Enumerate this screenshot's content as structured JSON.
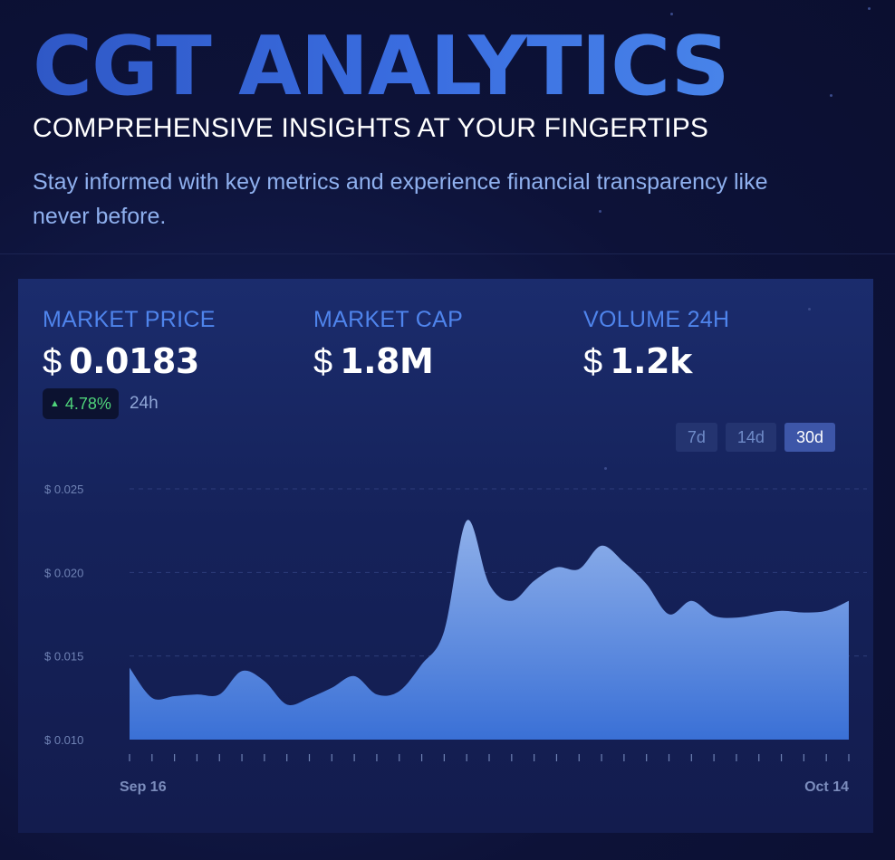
{
  "hero": {
    "title": "CGT ANALYTICS",
    "subtitle": "COMPREHENSIVE INSIGHTS AT YOUR FINGERTIPS",
    "description": "Stay informed with key metrics and experience financial transparency like never before."
  },
  "metrics": {
    "market_price": {
      "label": "MARKET PRICE",
      "currency": "$",
      "value": "0.0183"
    },
    "market_cap": {
      "label": "MARKET CAP",
      "currency": "$",
      "value": "1.8M"
    },
    "volume_24h": {
      "label": "VOLUME 24H",
      "currency": "$",
      "value": "1.2k"
    }
  },
  "change": {
    "arrow_icon": "triangle-up-icon",
    "value": "4.78%",
    "period": "24h",
    "color": "#4fd47b"
  },
  "range_buttons": [
    {
      "label": "7d",
      "active": false
    },
    {
      "label": "14d",
      "active": false
    },
    {
      "label": "30d",
      "active": true
    }
  ],
  "colors": {
    "background": "#0d1238",
    "accent": "#4f84ec",
    "area_top": "#8fb0ea",
    "area_bottom": "#3a70d6"
  },
  "chart_data": {
    "type": "area",
    "title": "",
    "xlabel": "",
    "ylabel": "",
    "ylim": [
      0.01,
      0.025
    ],
    "yticks": [
      {
        "value": 0.01,
        "label": "$ 0.010"
      },
      {
        "value": 0.015,
        "label": "$ 0.015"
      },
      {
        "value": 0.02,
        "label": "$ 0.020"
      },
      {
        "value": 0.025,
        "label": "$ 0.025"
      }
    ],
    "xtick_labels": [
      {
        "index": 0,
        "label": "Sep 16"
      },
      {
        "index": 32,
        "label": "Oct 14"
      }
    ],
    "grid": true,
    "series": [
      {
        "values": [
          0.0143,
          0.0125,
          0.0126,
          0.0127,
          0.0127,
          0.0141,
          0.0135,
          0.0121,
          0.0125,
          0.0131,
          0.0138,
          0.0127,
          0.0129,
          0.0145,
          0.0165,
          0.0231,
          0.0193,
          0.0183,
          0.0195,
          0.0203,
          0.0202,
          0.0216,
          0.0206,
          0.0193,
          0.0175,
          0.0183,
          0.0174,
          0.0173,
          0.0175,
          0.0177,
          0.0176,
          0.0177,
          0.0183
        ]
      }
    ]
  }
}
